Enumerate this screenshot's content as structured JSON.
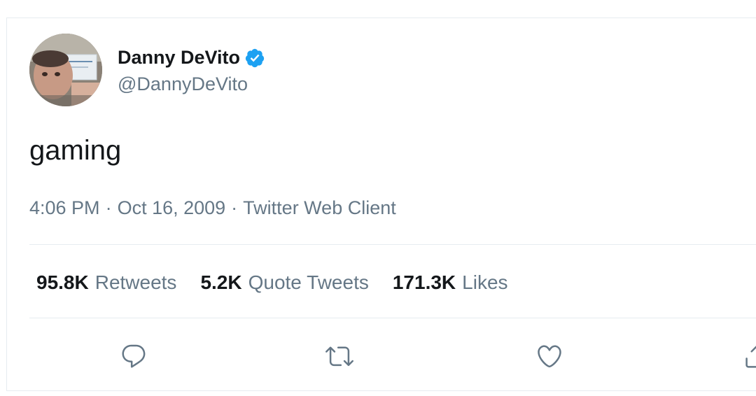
{
  "user": {
    "display_name": "Danny DeVito",
    "handle": "@DannyDeVito",
    "verified_icon": "verified-badge-icon",
    "avatar_icon": "avatar-photo"
  },
  "tweet": {
    "text": "gaming",
    "time": "4:06 PM",
    "separator": "·",
    "date": "Oct 16, 2009",
    "source": "Twitter Web Client"
  },
  "stats": {
    "retweets_count": "95.8K",
    "retweets_label": "Retweets",
    "quotes_count": "5.2K",
    "quotes_label": "Quote Tweets",
    "likes_count": "171.3K",
    "likes_label": "Likes"
  },
  "actions": [
    {
      "icon": "reply-icon"
    },
    {
      "icon": "retweet-icon"
    },
    {
      "icon": "like-icon"
    },
    {
      "icon": "share-icon"
    }
  ],
  "colors": {
    "text_primary": "#14171a",
    "text_secondary": "#657786",
    "verified_blue": "#1da1f2",
    "divider": "#e6ecf0"
  }
}
